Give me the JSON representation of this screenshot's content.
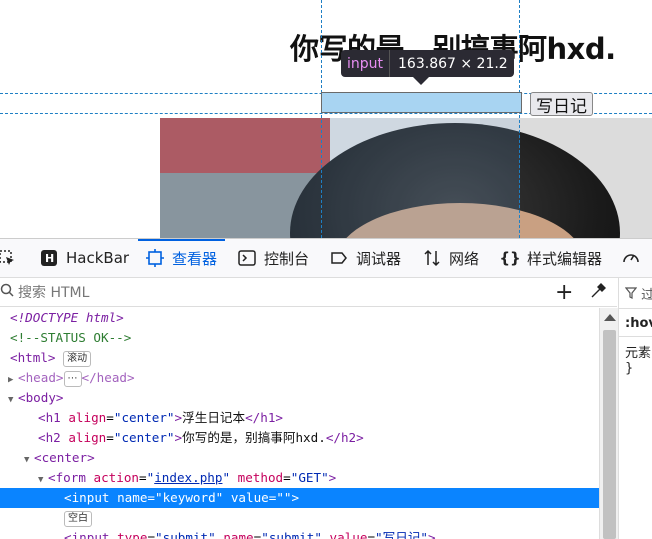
{
  "page": {
    "heading": "你写的是，别搞事阿hxd.",
    "submit_label": "写日记"
  },
  "inspector_tooltip": {
    "tag": "input",
    "dimensions": "163.867 × 21.2"
  },
  "devtools": {
    "tabs": [
      {
        "label": "HackBar",
        "icon": "hackbar-icon"
      },
      {
        "label": "查看器",
        "icon": "inspector-icon"
      },
      {
        "label": "控制台",
        "icon": "console-icon"
      },
      {
        "label": "调试器",
        "icon": "debugger-icon"
      },
      {
        "label": "网络",
        "icon": "network-icon"
      },
      {
        "label": "样式编辑器",
        "icon": "style-editor-icon"
      }
    ],
    "search_placeholder": "搜索 HTML",
    "side_panel": {
      "filter_label": "过",
      "hov_label": ":hov",
      "element_label": "元素",
      "brace": "}"
    },
    "markup_lines": {
      "doctype": "<!DOCTYPE html>",
      "comment": "<!--STATUS OK-->",
      "html_badge": "滚动",
      "h1_text": "浮生日记本",
      "h2_text": "你写的是，别搞事阿hxd.",
      "form_action": "index.php",
      "form_method": "GET",
      "input_name": "keyword",
      "input_value": "",
      "whitespace_badge": "空白",
      "input2_type": "submit",
      "input2_name": "submit",
      "input2_value": "写日记"
    }
  }
}
